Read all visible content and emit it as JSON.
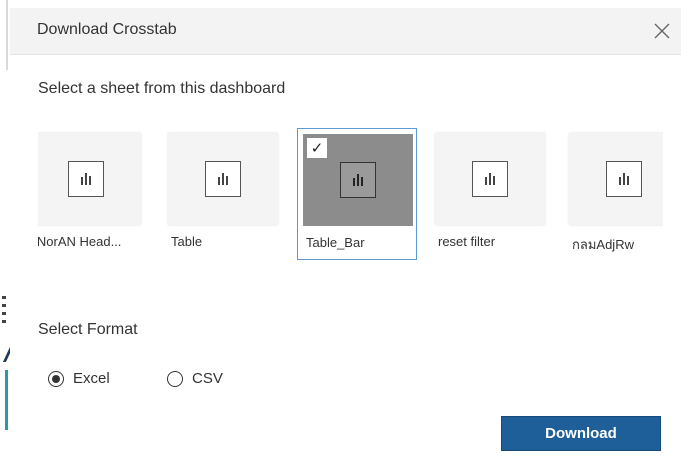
{
  "dialog": {
    "title": "Download Crosstab",
    "close_icon": "close-icon"
  },
  "sheets_section": {
    "label": "Select a sheet from this dashboard",
    "items": [
      {
        "label": "lNorAN Head...",
        "selected": false,
        "icon": "bar-chart-icon"
      },
      {
        "label": "Table",
        "selected": false,
        "icon": "bar-chart-icon"
      },
      {
        "label": "Table_Bar",
        "selected": true,
        "icon": "bar-chart-icon"
      },
      {
        "label": "reset filter",
        "selected": false,
        "icon": "bar-chart-icon"
      },
      {
        "label": "กลมAdjRw",
        "selected": false,
        "icon": "bar-chart-icon"
      }
    ],
    "check_mark": "✓"
  },
  "format_section": {
    "label": "Select Format",
    "options": [
      {
        "label": "Excel",
        "selected": true
      },
      {
        "label": "CSV",
        "selected": false
      }
    ]
  },
  "actions": {
    "download_label": "Download"
  },
  "colors": {
    "header_bg": "#f3f3f3",
    "selected_border": "#5b9bd5",
    "selected_thumb": "#8c8c8c",
    "primary_button": "#1f5f99"
  }
}
